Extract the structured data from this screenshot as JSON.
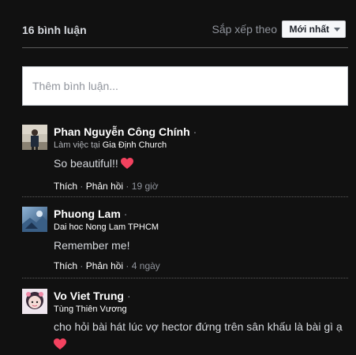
{
  "header": {
    "count_label": "16 bình luận",
    "sort_label": "Sắp xếp theo",
    "sort_value": "Mới nhất"
  },
  "input": {
    "placeholder": "Thêm bình luận..."
  },
  "comments": [
    {
      "name": "Phan Nguyễn Công Chính",
      "separator": "·",
      "work_prefix": "Làm việc tại ",
      "work_place": "Gia Định Church",
      "text": "So beautiful!!",
      "like": "Thích",
      "reply": "Phản hồi",
      "time": "19 giờ"
    },
    {
      "name": "Phuong Lam",
      "separator": "·",
      "subtitle": "Dai hoc Nong Lam TPHCM",
      "text": "Remember me!",
      "like": "Thích",
      "reply": "Phản hồi",
      "time": "4 ngày"
    },
    {
      "name": "Vo Viet Trung",
      "separator": "·",
      "subtitle": "Tùng Thiên Vương",
      "text": "cho hỏi bài hát lúc vợ hector đứng trên sân khấu là bài gì ạ"
    }
  ],
  "colors": {
    "background": "#111111",
    "heart": "#f3425f"
  }
}
